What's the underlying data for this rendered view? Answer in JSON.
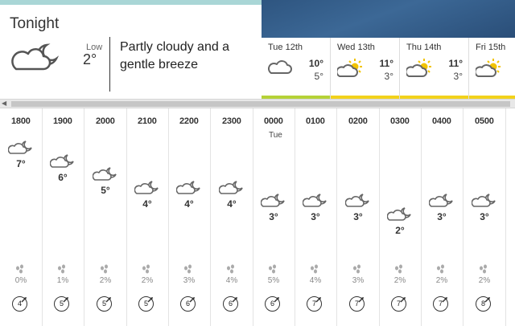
{
  "tonight": {
    "title": "Tonight",
    "icon": "partly-cloudy-night-icon",
    "low_label": "Low",
    "low_temp": "2°",
    "summary": "Partly cloudy and a gentle breeze"
  },
  "days": [
    {
      "name": "Tue 12th",
      "icon": "partly-cloudy-icon",
      "high": "10°",
      "low": "5°",
      "bar_color": "#b5d237"
    },
    {
      "name": "Wed 13th",
      "icon": "sunny-intervals-icon",
      "high": "11°",
      "low": "3°",
      "bar_color": "#f2d21b"
    },
    {
      "name": "Thu 14th",
      "icon": "sunny-intervals-icon",
      "high": "11°",
      "low": "3°",
      "bar_color": "#f2d21b"
    },
    {
      "name": "Fri 15th",
      "icon": "sunny-intervals-icon",
      "high": "",
      "low": "",
      "bar_color": "#f2d21b"
    }
  ],
  "hours": [
    {
      "time": "1800",
      "day": "",
      "icon": "partly-cloudy-night-icon",
      "temp": "7°",
      "rain": "0%",
      "wind": "4"
    },
    {
      "time": "1900",
      "day": "",
      "icon": "partly-cloudy-night-icon",
      "temp": "6°",
      "rain": "1%",
      "wind": "5"
    },
    {
      "time": "2000",
      "day": "",
      "icon": "partly-cloudy-night-icon",
      "temp": "5°",
      "rain": "2%",
      "wind": "5"
    },
    {
      "time": "2100",
      "day": "",
      "icon": "partly-cloudy-night-icon",
      "temp": "4°",
      "rain": "2%",
      "wind": "5"
    },
    {
      "time": "2200",
      "day": "",
      "icon": "partly-cloudy-night-icon",
      "temp": "4°",
      "rain": "3%",
      "wind": "6"
    },
    {
      "time": "2300",
      "day": "",
      "icon": "partly-cloudy-night-icon",
      "temp": "4°",
      "rain": "4%",
      "wind": "6"
    },
    {
      "time": "0000",
      "day": "Tue",
      "icon": "partly-cloudy-night-icon",
      "temp": "3°",
      "rain": "5%",
      "wind": "6"
    },
    {
      "time": "0100",
      "day": "",
      "icon": "partly-cloudy-night-icon",
      "temp": "3°",
      "rain": "4%",
      "wind": "7"
    },
    {
      "time": "0200",
      "day": "",
      "icon": "partly-cloudy-night-icon",
      "temp": "3°",
      "rain": "3%",
      "wind": "7"
    },
    {
      "time": "0300",
      "day": "",
      "icon": "partly-cloudy-night-icon",
      "temp": "2°",
      "rain": "2%",
      "wind": "7"
    },
    {
      "time": "0400",
      "day": "",
      "icon": "partly-cloudy-night-icon",
      "temp": "3°",
      "rain": "2%",
      "wind": "7"
    },
    {
      "time": "0500",
      "day": "",
      "icon": "partly-cloudy-night-icon",
      "temp": "3°",
      "rain": "2%",
      "wind": "8"
    }
  ]
}
